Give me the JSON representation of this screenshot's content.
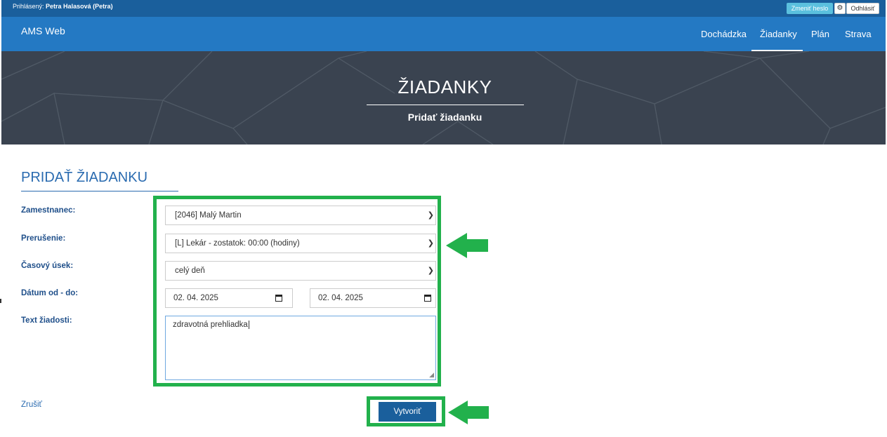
{
  "topbar": {
    "user_prefix": "Prihlásený:",
    "user_name": "Petra Halasová (Petra)",
    "change_password": "Zmeniť heslo",
    "logout": "Odhlásiť"
  },
  "navbar": {
    "brand": "AMS Web",
    "items": [
      {
        "label": "Dochádzka",
        "active": false
      },
      {
        "label": "Žiadanky",
        "active": true
      },
      {
        "label": "Plán",
        "active": false
      },
      {
        "label": "Strava",
        "active": false
      }
    ]
  },
  "hero": {
    "title": "ŽIADANKY",
    "subtitle": "Pridať žiadanku"
  },
  "form": {
    "heading": "PRIDAŤ ŽIADANKU",
    "employee_label": "Zamestnanec:",
    "employee_value": "[2046] Malý Martin",
    "interruption_label": "Prerušenie:",
    "interruption_value": "[L] Lekár - zostatok: 00:00 (hodiny)",
    "timeslot_label": "Časový úsek:",
    "timeslot_value": "celý deň",
    "date_label": "Dátum od - do:",
    "date_from": "02. 04. 2025",
    "date_to": "02. 04. 2025",
    "text_label": "Text žiadosti:",
    "text_value": "zdravotná prehliadka",
    "cancel": "Zrušiť",
    "create": "Vytvoriť"
  },
  "colors": {
    "navbar": "#2479c3",
    "topbar": "#1a5f9c",
    "highlight": "#22b14c",
    "heading": "#2a6bb0"
  },
  "icons": {
    "gear": "gear-icon",
    "chevron": "chevron-down-icon",
    "calendar": "calendar-icon",
    "arrow": "arrow-left-icon"
  }
}
